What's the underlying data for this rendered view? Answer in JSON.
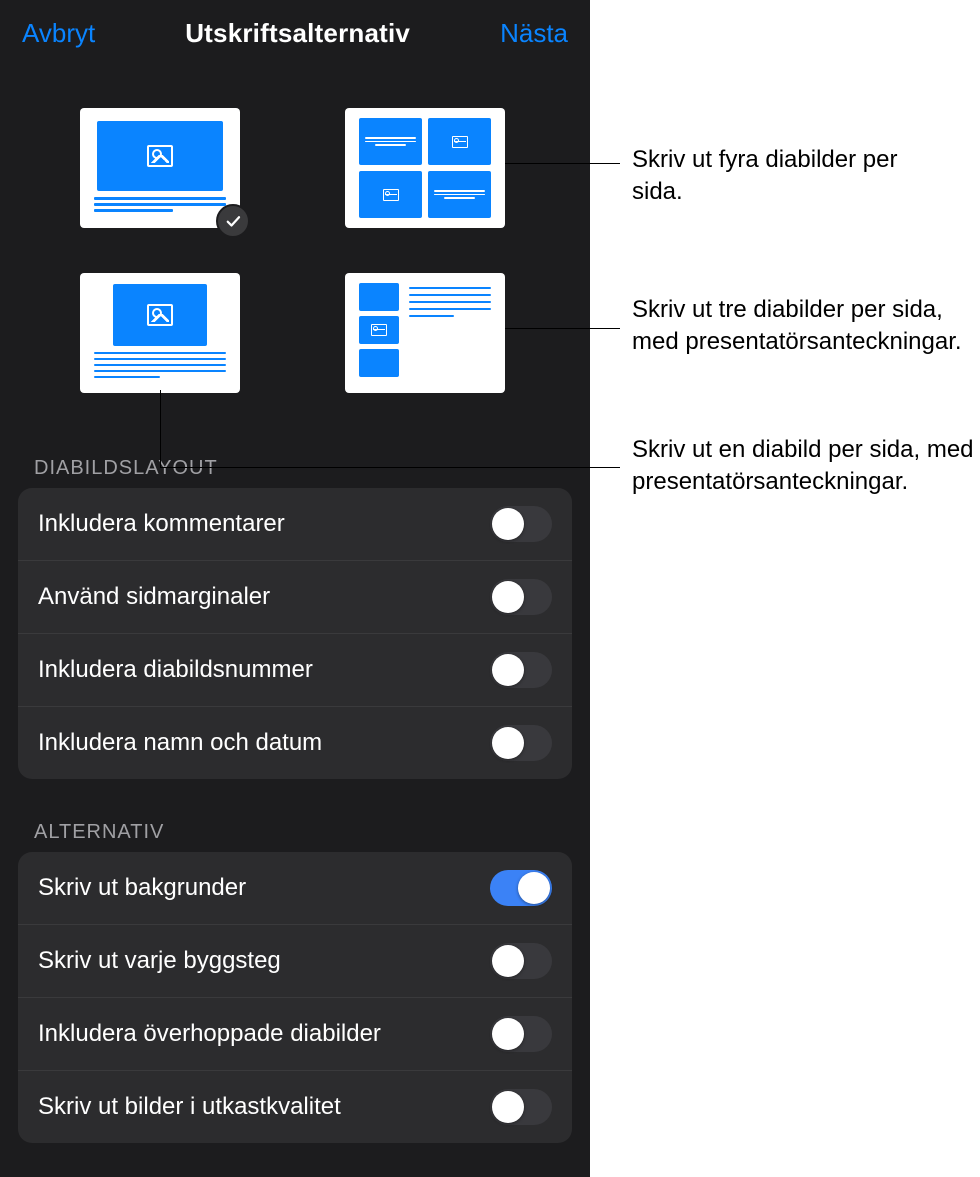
{
  "header": {
    "cancel": "Avbryt",
    "title": "Utskriftsalternativ",
    "next": "Nästa"
  },
  "sections": {
    "layout_title": "DIABILDSLAYOUT",
    "options_title": "ALTERNATIV"
  },
  "layout_rows": {
    "include_comments": "Inkludera kommentarer",
    "use_margins": "Använd sidmarginaler",
    "include_slide_numbers": "Inkludera diabildsnummer",
    "include_name_date": "Inkludera namn och datum"
  },
  "options_rows": {
    "print_backgrounds": "Skriv ut bakgrunder",
    "print_each_build": "Skriv ut varje byggsteg",
    "include_skipped": "Inkludera överhoppade diabilder",
    "print_draft_quality": "Skriv ut bilder i utkastkvalitet"
  },
  "toggles": {
    "include_comments": false,
    "use_margins": false,
    "include_slide_numbers": false,
    "include_name_date": false,
    "print_backgrounds": true,
    "print_each_build": false,
    "include_skipped": false,
    "print_draft_quality": false
  },
  "callouts": {
    "c1": "Skriv ut fyra diabilder per sida.",
    "c2": "Skriv ut tre diabilder per sida, med presentatörsanteckningar.",
    "c3": "Skriv ut en diabild per sida, med presentatörsanteckningar."
  }
}
